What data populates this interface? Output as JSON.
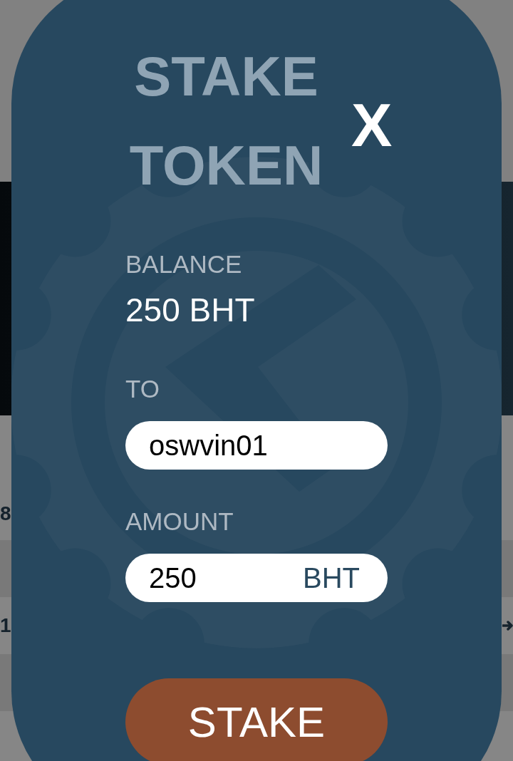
{
  "background_page": {
    "row_texts": [
      "8",
      "1"
    ]
  },
  "dialog": {
    "title": "STAKE TOKEN",
    "close_label": "X",
    "fields": [
      {
        "kind": "readout",
        "label": "BALANCE",
        "value": "250 BHT"
      },
      {
        "kind": "text",
        "label": "TO",
        "value": "oswvin01"
      },
      {
        "kind": "amount",
        "label": "AMOUNT",
        "value": "250",
        "unit": "BHT"
      }
    ],
    "submit_button": "STAKE"
  }
}
